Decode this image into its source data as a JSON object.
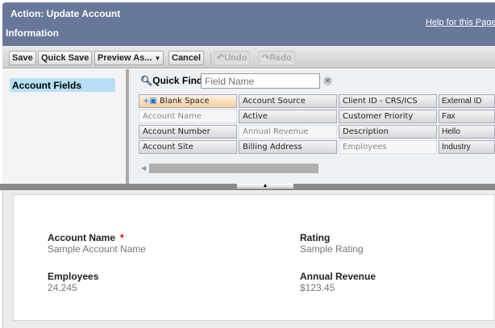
{
  "header": {
    "title_line1": "Action: Update Account",
    "title_line2": "Information",
    "help": "Help for this Page"
  },
  "toolbar": {
    "save": "Save",
    "quick_save": "Quick Save",
    "preview": "Preview As...",
    "cancel": "Cancel",
    "undo": "Undo",
    "redo": "Redo"
  },
  "sidebar": {
    "selected": "Account Fields"
  },
  "quick_find": {
    "label": "Quick Find",
    "placeholder": "Field Name"
  },
  "palette": {
    "columns": [
      [
        {
          "label": "Blank Space",
          "state": "blank"
        },
        {
          "label": "Account Name",
          "state": "used"
        },
        {
          "label": "Account Number",
          "state": "normal"
        },
        {
          "label": "Account Site",
          "state": "normal"
        }
      ],
      [
        {
          "label": "Account Source",
          "state": "normal"
        },
        {
          "label": "Active",
          "state": "normal"
        },
        {
          "label": "Annual Revenue",
          "state": "used"
        },
        {
          "label": "Billing Address",
          "state": "normal"
        }
      ],
      [
        {
          "label": "Client ID - CRS/ICS",
          "state": "normal"
        },
        {
          "label": "Customer Priority",
          "state": "normal"
        },
        {
          "label": "Description",
          "state": "normal"
        },
        {
          "label": "Employees",
          "state": "used"
        }
      ],
      [
        {
          "label": "External ID",
          "state": "normal"
        },
        {
          "label": "Fax",
          "state": "normal"
        },
        {
          "label": "Hello",
          "state": "normal"
        },
        {
          "label": "Industry",
          "state": "normal"
        }
      ]
    ]
  },
  "layout": {
    "fields": [
      {
        "label": "Account Name",
        "value": "Sample Account Name",
        "required": "*"
      },
      {
        "label": "Rating",
        "value": "Sample Rating"
      },
      {
        "label": "Employees",
        "value": "24,245"
      },
      {
        "label": "Annual Revenue",
        "value": "$123.45"
      }
    ]
  }
}
